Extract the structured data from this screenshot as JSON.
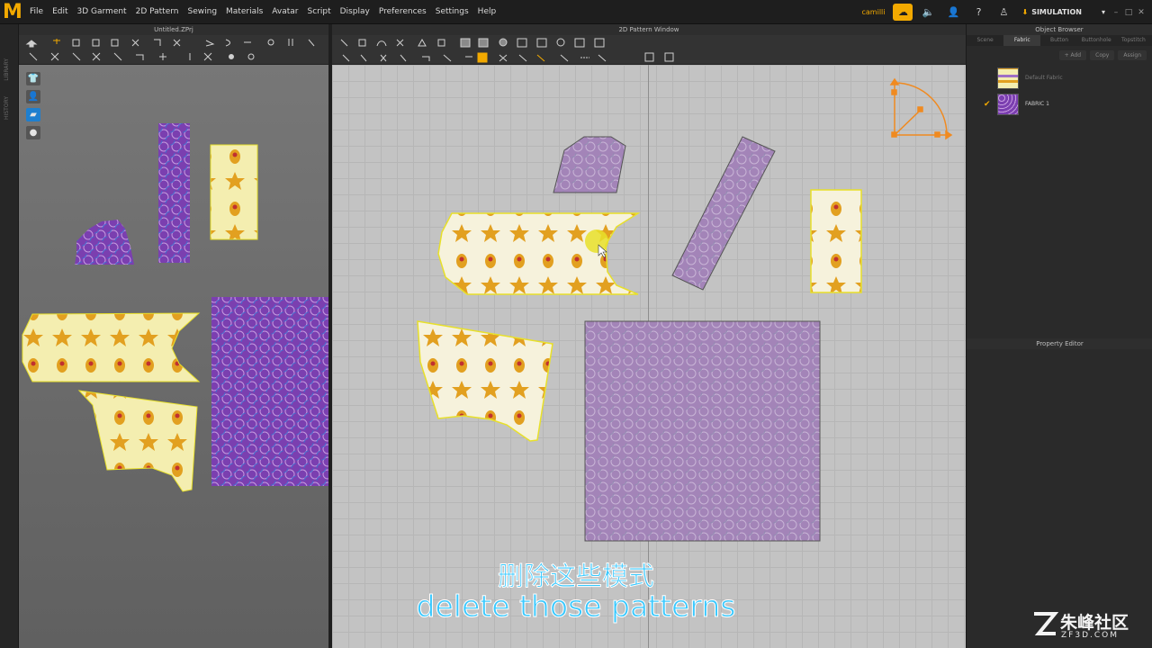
{
  "app": {
    "logo_letter": "M",
    "menu": [
      "File",
      "Edit",
      "3D Garment",
      "2D Pattern",
      "Sewing",
      "Materials",
      "Avatar",
      "Script",
      "Display",
      "Preferences",
      "Settings",
      "Help"
    ],
    "user": "camilli",
    "mode": "SIMULATION"
  },
  "left_strip": {
    "labels": [
      "LIBRARY",
      "HISTORY"
    ]
  },
  "window3d": {
    "title": "Untitled.ZPrj"
  },
  "window2d": {
    "title": "2D Pattern Window"
  },
  "object_browser": {
    "title": "Object Browser",
    "tabs": [
      "Scene",
      "Fabric",
      "Button",
      "Buttonhole",
      "Topstitch"
    ],
    "active_tab": "Fabric",
    "actions": [
      "+ Add",
      "Copy",
      "Assign"
    ],
    "fabrics": [
      {
        "name": "Default Fabric",
        "selected": false
      },
      {
        "name": "FABRIC 1",
        "selected": true
      }
    ]
  },
  "property_editor": {
    "title": "Property Editor"
  },
  "subtitles": {
    "chinese": "删除这些模式",
    "english": "delete those patterns"
  },
  "watermark": {
    "text": "朱峰社区",
    "sub": "ZF3D.COM"
  },
  "colors": {
    "accent": "#f2a900",
    "selection_outline": "#e8e02a",
    "subtitle": "#38c8ff"
  }
}
